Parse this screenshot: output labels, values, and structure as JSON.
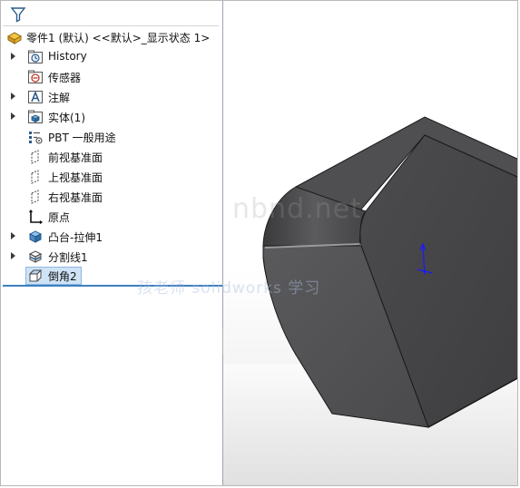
{
  "tree": {
    "root_label": "零件1 (默认) <<默认>_显示状态 1>",
    "items": [
      {
        "label": "History",
        "icon": "history-folder-icon",
        "expandable": true
      },
      {
        "label": "传感器",
        "icon": "sensor-folder-icon",
        "expandable": false
      },
      {
        "label": "注解",
        "icon": "annotations-icon",
        "expandable": true
      },
      {
        "label": "实体(1)",
        "icon": "solid-bodies-icon",
        "expandable": true
      },
      {
        "label": "PBT 一般用途",
        "icon": "material-icon",
        "expandable": false
      },
      {
        "label": "前视基准面",
        "icon": "plane-icon",
        "expandable": false
      },
      {
        "label": "上视基准面",
        "icon": "plane-icon",
        "expandable": false
      },
      {
        "label": "右视基准面",
        "icon": "plane-icon",
        "expandable": false
      },
      {
        "label": "原点",
        "icon": "origin-icon",
        "expandable": false
      },
      {
        "label": "凸台-拉伸1",
        "icon": "boss-extrude-icon",
        "expandable": true
      },
      {
        "label": "分割线1",
        "icon": "split-line-icon",
        "expandable": true
      },
      {
        "label": "倒角2",
        "icon": "chamfer-icon",
        "expandable": false,
        "selected": true
      }
    ]
  },
  "watermark": {
    "line1": "nbnd.net",
    "line2": "孩老师 solidworks 学习"
  },
  "colors": {
    "rollback_bar": "#3d7fc1",
    "selection": "#cfe3f7",
    "model_face": "#4a4a4c",
    "axis": "#1a1aff"
  }
}
